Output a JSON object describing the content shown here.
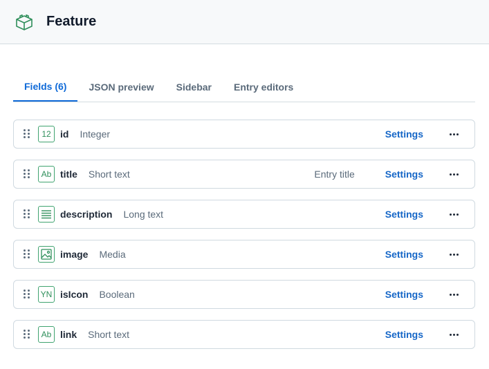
{
  "header": {
    "title": "Feature",
    "icon": "cube-icon"
  },
  "tabs": [
    {
      "label": "Fields (6)",
      "active": true
    },
    {
      "label": "JSON preview",
      "active": false
    },
    {
      "label": "Sidebar",
      "active": false
    },
    {
      "label": "Entry editors",
      "active": false
    }
  ],
  "fields": [
    {
      "name": "id",
      "type": "Integer",
      "icon_text": "12",
      "icon": "integer-icon",
      "extra": "",
      "settings": "Settings"
    },
    {
      "name": "title",
      "type": "Short text",
      "icon_text": "Ab",
      "icon": "short-text-icon",
      "extra": "Entry title",
      "settings": "Settings"
    },
    {
      "name": "description",
      "type": "Long text",
      "icon_text": "",
      "icon": "long-text-icon",
      "extra": "",
      "settings": "Settings"
    },
    {
      "name": "image",
      "type": "Media",
      "icon_text": "",
      "icon": "media-icon",
      "extra": "",
      "settings": "Settings"
    },
    {
      "name": "isIcon",
      "type": "Boolean",
      "icon_text": "YN",
      "icon": "boolean-icon",
      "extra": "",
      "settings": "Settings"
    },
    {
      "name": "link",
      "type": "Short text",
      "icon_text": "Ab",
      "icon": "short-text-icon",
      "extra": "",
      "settings": "Settings"
    }
  ],
  "colors": {
    "accent": "#0f6ad8",
    "field_icon": "#3fa36f"
  }
}
